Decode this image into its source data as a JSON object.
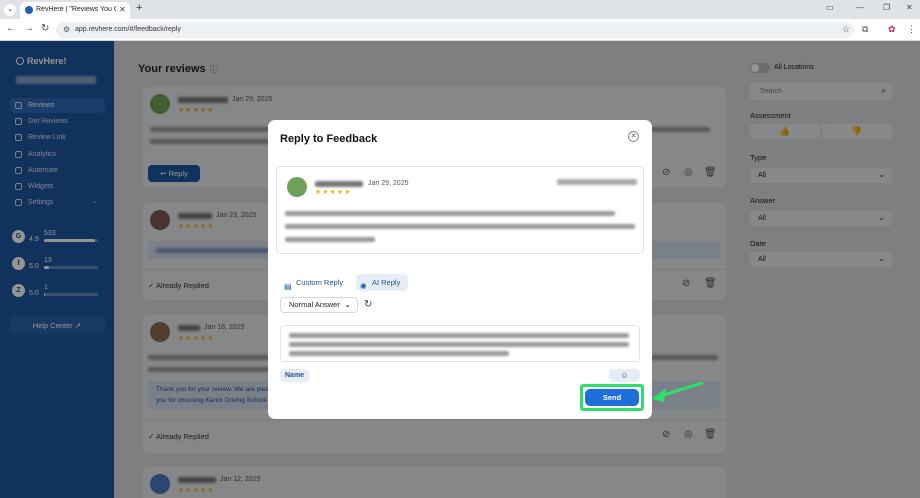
{
  "browser": {
    "tab_title": "RevHere | \"Reviews You Can Tr...",
    "url": "app.revhere.com/#/feedback/reply"
  },
  "sidebar": {
    "logo": "RevHere!",
    "items": [
      {
        "label": "Reviews"
      },
      {
        "label": "Get Reviews"
      },
      {
        "label": "Review Link"
      },
      {
        "label": "Analytics"
      },
      {
        "label": "Automate"
      },
      {
        "label": "Widgets"
      },
      {
        "label": "Settings"
      }
    ],
    "ratings": [
      {
        "icon": "G",
        "score": "4.9",
        "count": "533",
        "fill": 0.95
      },
      {
        "icon": "f",
        "score": "5.0",
        "count": "13",
        "fill": 0.1
      },
      {
        "icon": "Z",
        "score": "5.0",
        "count": "1",
        "fill": 0.02
      }
    ],
    "help": "Help Center"
  },
  "main": {
    "title": "Your reviews",
    "reviews": [
      {
        "date": "Jan 29, 2025",
        "stars": "★★★★★",
        "action": "Reply"
      },
      {
        "date": "Jan 23, 2025",
        "stars": "★★★★★",
        "status": "Already Replied"
      },
      {
        "date": "Jan 18, 2025",
        "stars": "★★★★★",
        "status": "Already Replied",
        "reply_line1": "Thank you for your review. We are plea",
        "reply_line2": "you for choosing Kanor Driving School."
      },
      {
        "date": "Jan 12, 2025",
        "stars": "★★★★★"
      }
    ]
  },
  "filters": {
    "all_locations": "All Locations",
    "search_placeholder": "Search",
    "assessment": "Assessment",
    "type_label": "Type",
    "type_value": "All",
    "answer_label": "Answer",
    "answer_value": "All",
    "date_label": "Date",
    "date_value": "All"
  },
  "modal": {
    "title": "Reply to Feedback",
    "date": "Jan 29, 2025",
    "stars": "★★★★★",
    "tab_custom": "Custom Reply",
    "tab_ai": "AI Reply",
    "tone": "Normal Answer",
    "name_chip": "Name",
    "send": "Send"
  }
}
